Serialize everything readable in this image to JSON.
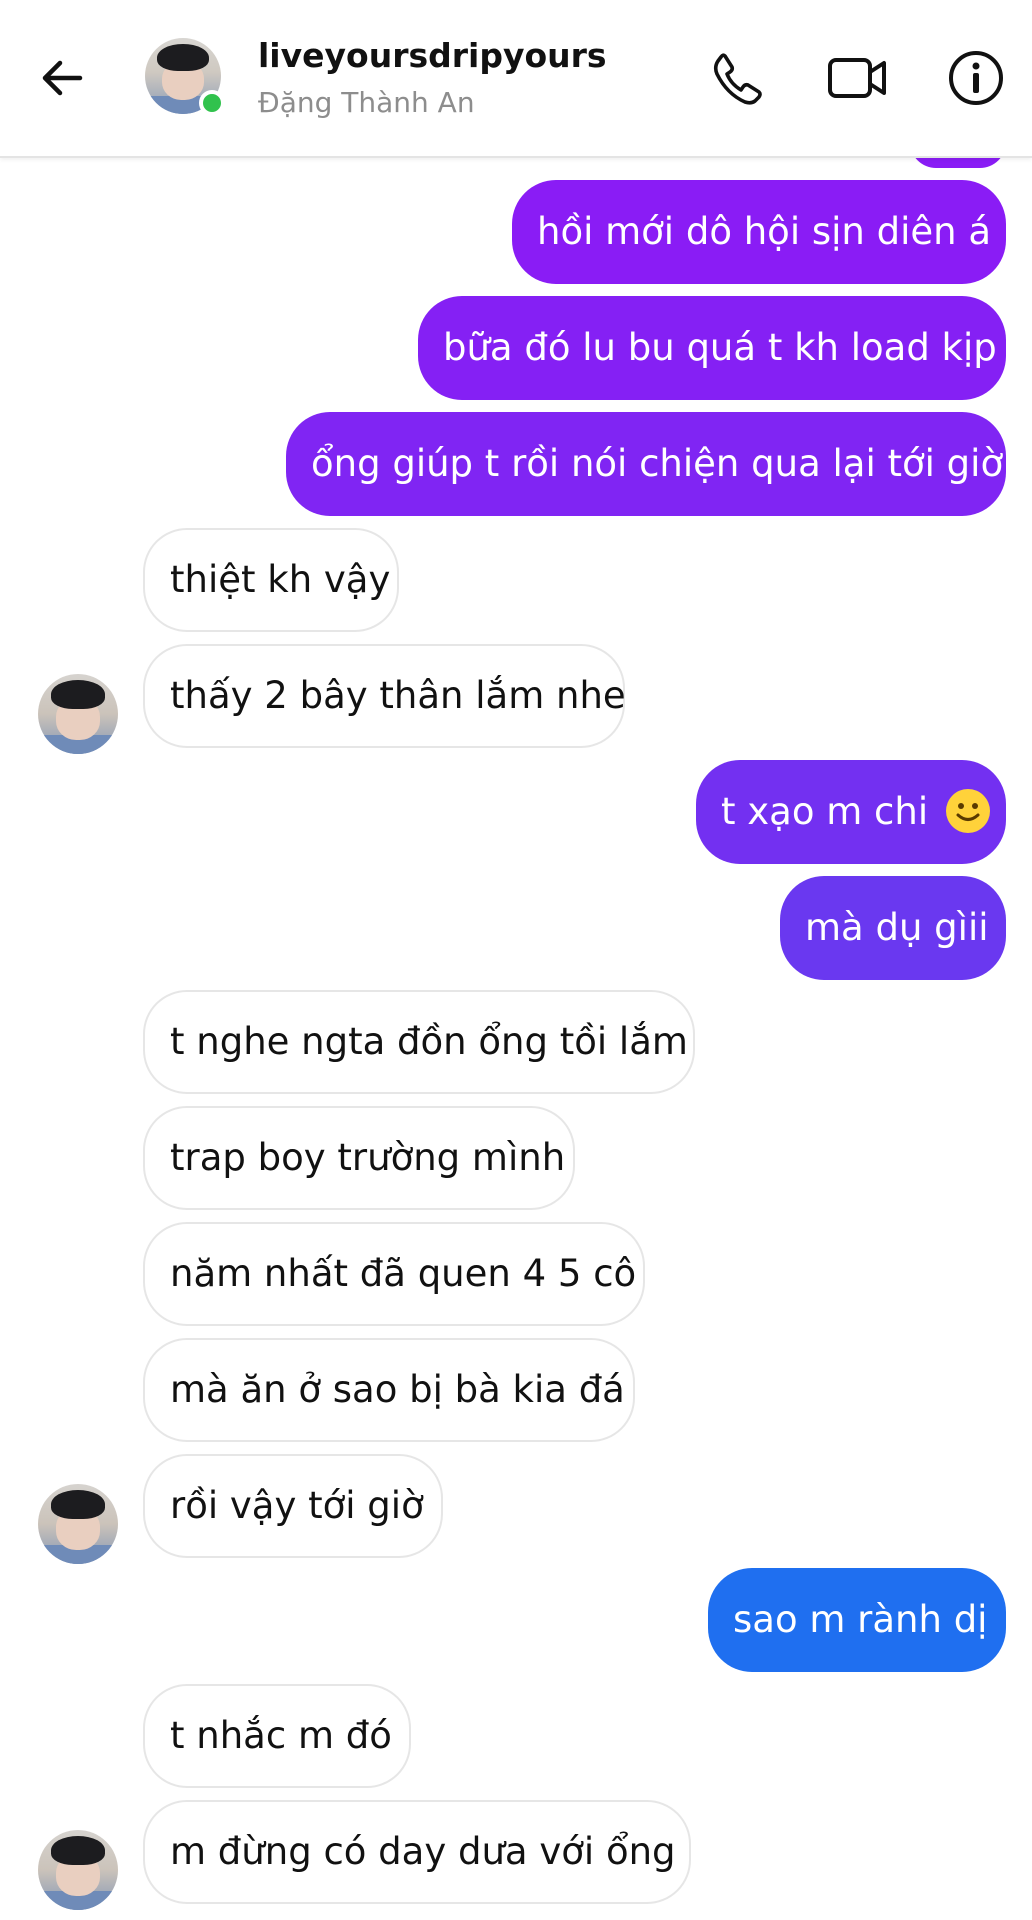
{
  "header": {
    "title": "liveyoursdripyours",
    "subtitle": "Đặng Thành An",
    "icons": [
      "back-arrow-icon",
      "phone-icon",
      "video-camera-icon",
      "info-icon"
    ]
  },
  "colors": {
    "purple": "#8a1cf5",
    "violet": "#6f35f0",
    "blue": "#1f6ff0",
    "online": "#31c24d"
  },
  "messages": [
    {
      "side": "out",
      "text": "hồi mới dô hội sịn diên á"
    },
    {
      "side": "out",
      "text": "bữa đó lu bu quá t kh load kịp"
    },
    {
      "side": "out",
      "text": "ổng giúp t rồi nói chiện qua lại tới giờ"
    },
    {
      "side": "in",
      "text": "thiệt kh vậy"
    },
    {
      "side": "in",
      "text": "thấy 2 bây thân lắm nhe"
    },
    {
      "side": "out",
      "text": "t xạo m chi"
    },
    {
      "side": "out",
      "text": "mà dụ gìii"
    },
    {
      "side": "in",
      "text": "t nghe ngta đồn ổng tồi lắm"
    },
    {
      "side": "in",
      "text": "trap boy trường mình"
    },
    {
      "side": "in",
      "text": "năm nhất đã quen 4 5 cô"
    },
    {
      "side": "in",
      "text": "mà ăn ở sao bị bà kia đá"
    },
    {
      "side": "in",
      "text": "rồi vậy tới giờ"
    },
    {
      "side": "out",
      "text": "sao m rành dị"
    },
    {
      "side": "in",
      "text": "t nhắc m đó"
    },
    {
      "side": "in",
      "text": "m đừng có day dưa với ổng"
    }
  ]
}
